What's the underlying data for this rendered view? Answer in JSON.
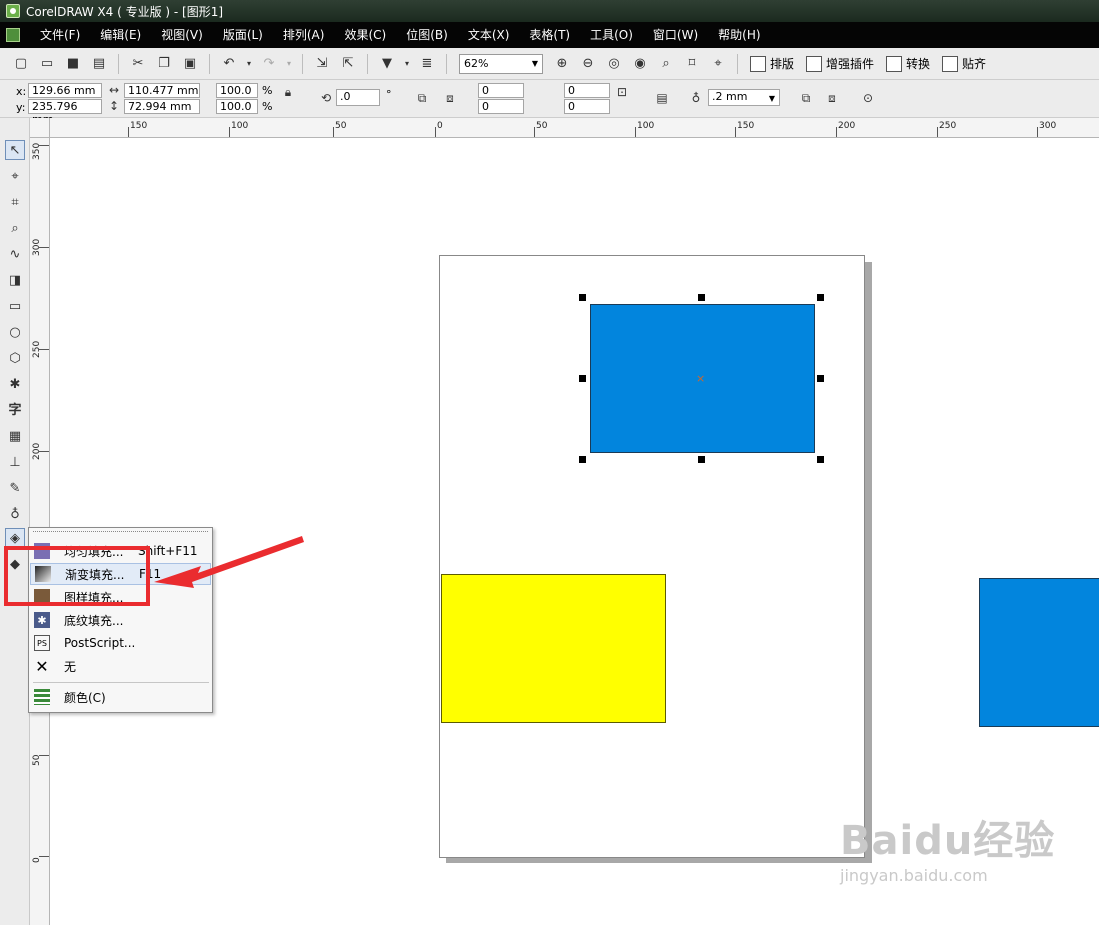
{
  "window": {
    "title": "CorelDRAW X4 ( 专业版 ) - [图形1]"
  },
  "menu": [
    "文件(F)",
    "编辑(E)",
    "视图(V)",
    "版面(L)",
    "排列(A)",
    "效果(C)",
    "位图(B)",
    "文本(X)",
    "表格(T)",
    "工具(O)",
    "窗口(W)",
    "帮助(H)"
  ],
  "toolbar": {
    "zoom": "62%",
    "text_buttons": [
      "排版",
      "增强插件",
      "转换",
      "贴齐"
    ]
  },
  "property_bar": {
    "x": "129.66 mm",
    "y": "235.796 mm",
    "width": "110.477 mm",
    "height": "72.994 mm",
    "scale_x": "100.0",
    "scale_y": "100.0",
    "percent": "%",
    "rotation": ".0",
    "degree": "°",
    "corner_values": [
      "0",
      "0",
      "0",
      "0"
    ],
    "outline_width": ".2 mm",
    "x_label": "x:",
    "y_label": "y:"
  },
  "ruler_top_labels": [
    "150",
    "100",
    "50",
    "0",
    "50",
    "100",
    "150",
    "200",
    "250",
    "300"
  ],
  "ruler_left_labels": [
    "350",
    "300",
    "250",
    "200",
    "50",
    "0"
  ],
  "flyout": {
    "items": [
      {
        "label": "均匀填充...",
        "shortcut": "Shift+F11"
      },
      {
        "label": "渐变填充...",
        "shortcut": "F11"
      },
      {
        "label": "图样填充..."
      },
      {
        "label": "底纹填充..."
      },
      {
        "label": "PostScript..."
      },
      {
        "label": "无"
      },
      {
        "label": "颜色(C)"
      }
    ]
  },
  "colors": {
    "selected_rect": "#0285dd",
    "yellow_rect": "#ffff00",
    "annotation": "#ea2c2f"
  },
  "watermark": {
    "main": "Baidu经验",
    "sub": "jingyan.baidu.com"
  }
}
